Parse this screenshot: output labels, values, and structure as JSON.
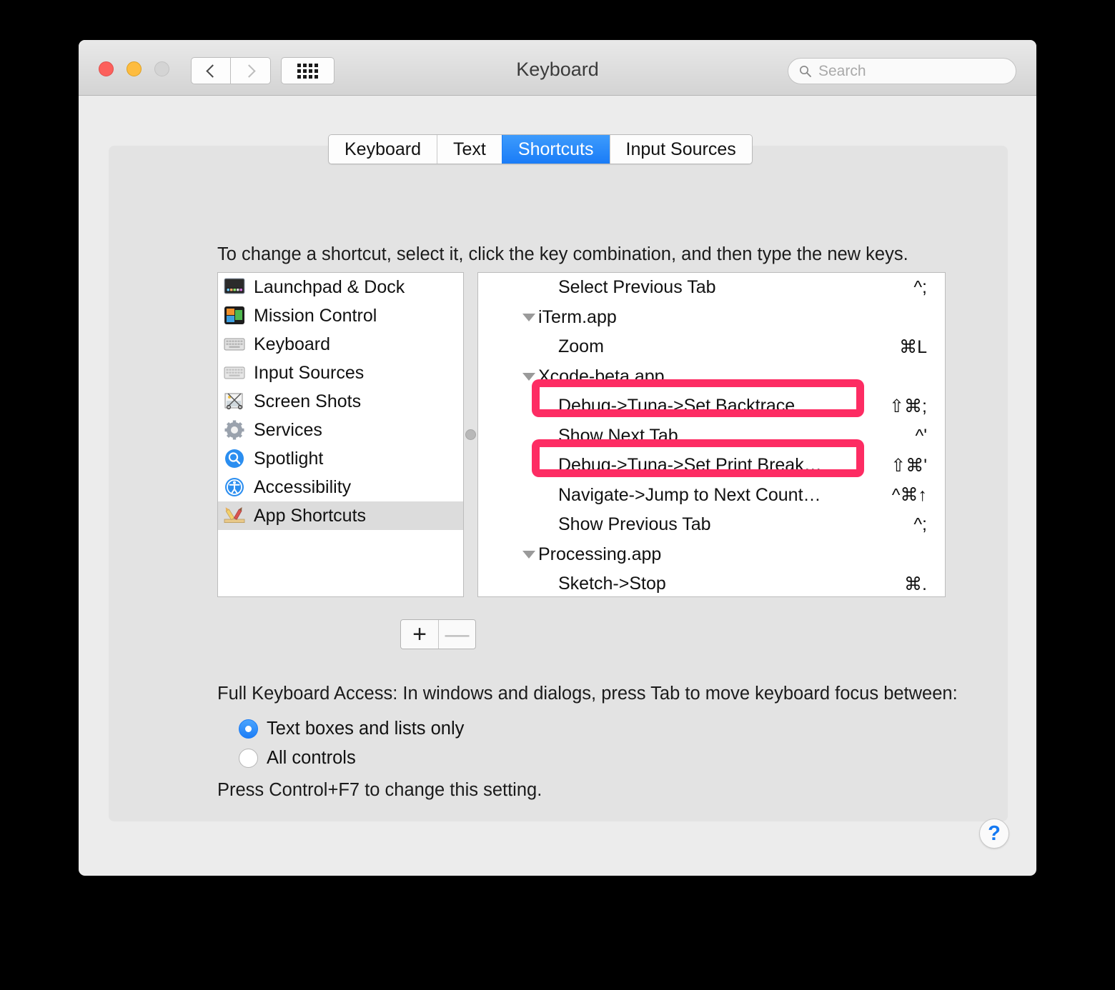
{
  "window": {
    "title": "Keyboard",
    "traffic_lights": [
      "close",
      "minimize",
      "zoom"
    ],
    "nav": {
      "back": "back-arrow",
      "forward": "forward-arrow",
      "grid": "show-all-grid"
    }
  },
  "search": {
    "value": "",
    "placeholder": "Search",
    "icon": "search-icon"
  },
  "tabs": [
    {
      "label": "Keyboard",
      "active": false
    },
    {
      "label": "Text",
      "active": false
    },
    {
      "label": "Shortcuts",
      "active": true
    },
    {
      "label": "Input Sources",
      "active": false
    }
  ],
  "hint": "To change a shortcut, select it, click the key combination, and then type the new keys.",
  "sidebar": {
    "items": [
      {
        "label": "Launchpad & Dock",
        "icon": "launchpad-dock-icon",
        "selected": false
      },
      {
        "label": "Mission Control",
        "icon": "mission-control-icon",
        "selected": false
      },
      {
        "label": "Keyboard",
        "icon": "keyboard-icon",
        "selected": false
      },
      {
        "label": "Input Sources",
        "icon": "input-sources-icon",
        "selected": false
      },
      {
        "label": "Screen Shots",
        "icon": "screen-shots-icon",
        "selected": false
      },
      {
        "label": "Services",
        "icon": "services-gear-icon",
        "selected": false
      },
      {
        "label": "Spotlight",
        "icon": "spotlight-icon",
        "selected": false
      },
      {
        "label": "Accessibility",
        "icon": "accessibility-icon",
        "selected": false
      },
      {
        "label": "App Shortcuts",
        "icon": "app-shortcuts-icon",
        "selected": true
      }
    ]
  },
  "shortcut_list": {
    "rows": [
      {
        "type": "item",
        "label": "Select Previous Tab",
        "keys": "^;",
        "highlighted": false
      },
      {
        "type": "group",
        "label": "iTerm.app",
        "expanded": true
      },
      {
        "type": "item",
        "label": "Zoom",
        "keys": "⌘L",
        "highlighted": false
      },
      {
        "type": "group",
        "label": "Xcode-beta.app",
        "expanded": true
      },
      {
        "type": "item",
        "label": "Debug->Tuna->Set Backtrace…",
        "keys": "⇧⌘;",
        "highlighted": true
      },
      {
        "type": "item",
        "label": "Show Next Tab",
        "keys": "^'",
        "highlighted": false
      },
      {
        "type": "item",
        "label": "Debug->Tuna->Set Print Break…",
        "keys": "⇧⌘'",
        "highlighted": true
      },
      {
        "type": "item",
        "label": "Navigate->Jump to Next Count…",
        "keys": "^⌘↑",
        "highlighted": false
      },
      {
        "type": "item",
        "label": "Show Previous Tab",
        "keys": "^;",
        "highlighted": false
      },
      {
        "type": "group",
        "label": "Processing.app",
        "expanded": true
      },
      {
        "type": "item",
        "label": "Sketch->Stop",
        "keys": "⌘.",
        "highlighted": false
      }
    ]
  },
  "list_buttons": {
    "add": "+",
    "remove": "—",
    "remove_disabled": true
  },
  "full_keyboard_access": {
    "label": "Full Keyboard Access: In windows and dialogs, press Tab to move keyboard focus between:",
    "options": [
      {
        "label": "Text boxes and lists only",
        "selected": true
      },
      {
        "label": "All controls",
        "selected": false
      }
    ],
    "note": "Press Control+F7 to change this setting."
  },
  "help": {
    "label": "?"
  },
  "colors": {
    "accent_blue": "#1a7cf7",
    "highlight_pink": "#fd2c63",
    "window_bg": "#ececec",
    "panel_bg": "#e3e3e3"
  }
}
